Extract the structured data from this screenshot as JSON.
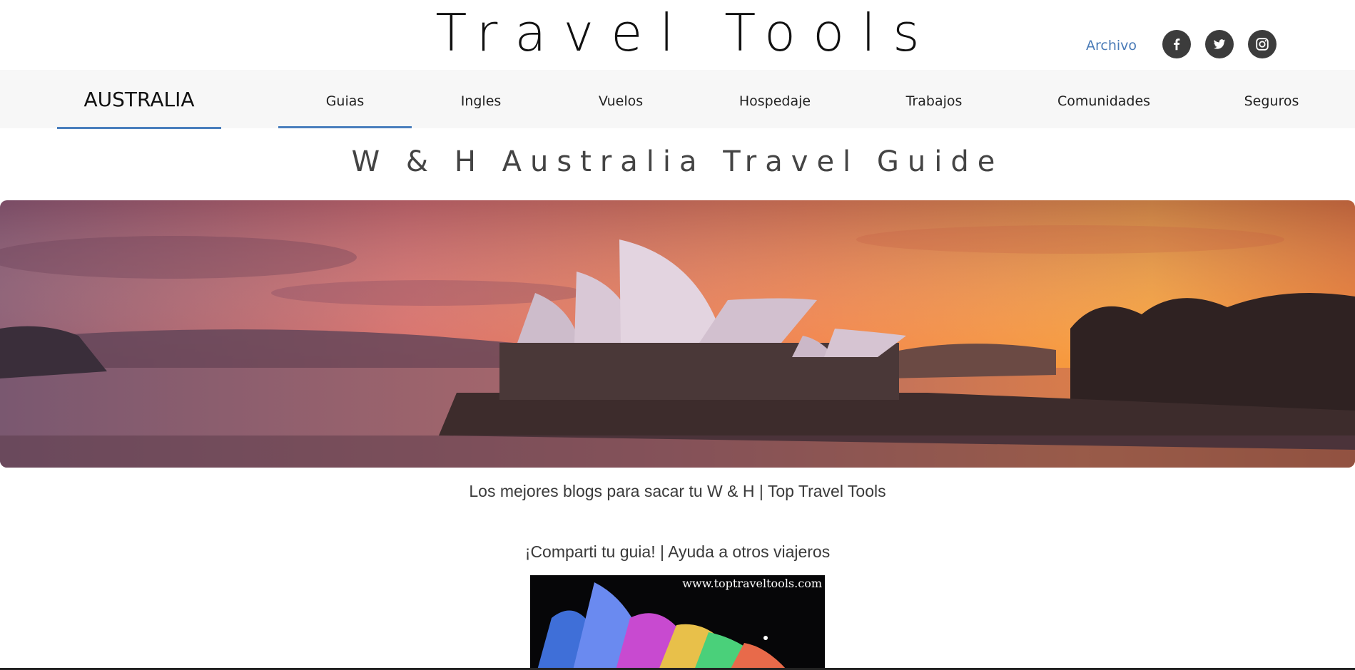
{
  "header": {
    "site_title": "Travel Tools",
    "archive_link": "Archivo",
    "social_icons": [
      "facebook-icon",
      "twitter-icon",
      "instagram-icon"
    ]
  },
  "nav": {
    "brand": "AUSTRALIA",
    "items": [
      {
        "label": "Guias",
        "active": true
      },
      {
        "label": "Ingles"
      },
      {
        "label": "Vuelos"
      },
      {
        "label": "Hospedaje"
      },
      {
        "label": "Trabajos"
      },
      {
        "label": "Comunidades"
      },
      {
        "label": "Seguros"
      }
    ],
    "accent_color": "#4a7fbd"
  },
  "main": {
    "guide_title": "W & H Australia Travel Guide",
    "caption_1": "Los mejores blogs para sacar tu W & H | Top Travel Tools",
    "caption_2": "¡Comparti tu guia! | Ayuda a otros viajeros",
    "thumbnail_watermark": "www.toptraveltools.com"
  }
}
